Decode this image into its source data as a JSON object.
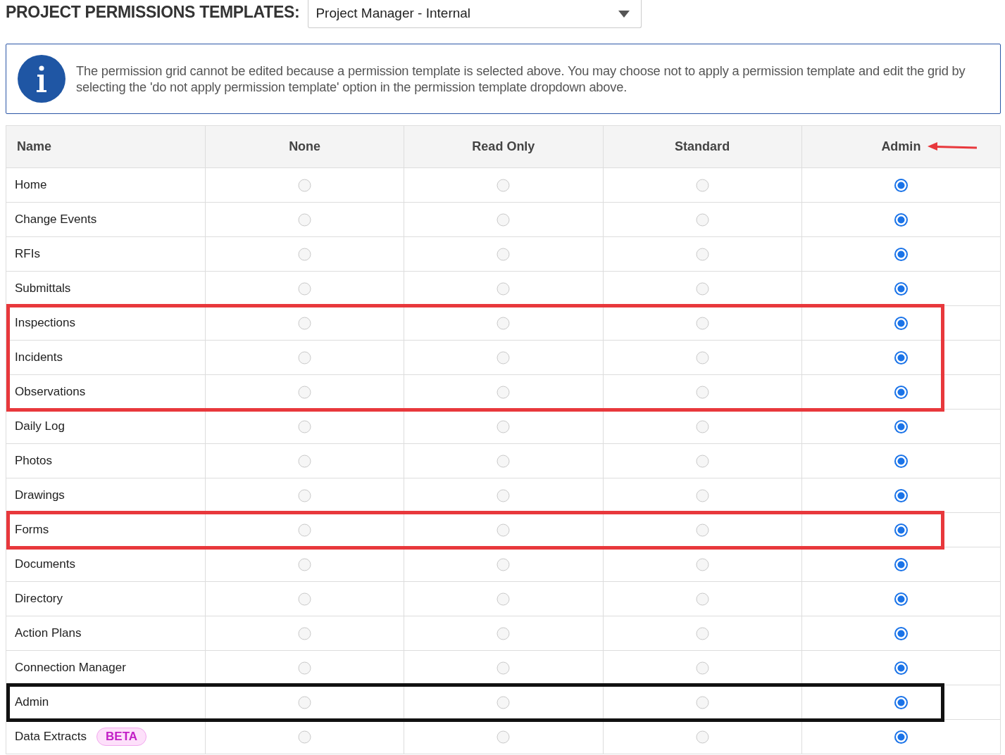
{
  "template": {
    "label": "PROJECT PERMISSIONS TEMPLATES:",
    "value": "Project Manager - Internal"
  },
  "info": {
    "text": "The permission grid cannot be edited because a permission template is selected above. You may choose not to apply a permission template and edit the grid by selecting the 'do not apply permission template' option in the permission template dropdown above."
  },
  "table": {
    "columns": [
      {
        "label": "Name",
        "arrow": false
      },
      {
        "label": "None",
        "arrow": false
      },
      {
        "label": "Read Only",
        "arrow": false
      },
      {
        "label": "Standard",
        "arrow": false
      },
      {
        "label": "Admin",
        "arrow": true
      }
    ],
    "rows": [
      {
        "name": "Home",
        "choices": [
          {
            "selected": false
          },
          {
            "selected": false
          },
          {
            "selected": false
          },
          {
            "selected": true
          }
        ]
      },
      {
        "name": "Change Events",
        "choices": [
          {
            "selected": false
          },
          {
            "selected": false
          },
          {
            "selected": false
          },
          {
            "selected": true
          }
        ]
      },
      {
        "name": "RFIs",
        "choices": [
          {
            "selected": false
          },
          {
            "selected": false
          },
          {
            "selected": false
          },
          {
            "selected": true
          }
        ]
      },
      {
        "name": "Submittals",
        "choices": [
          {
            "selected": false
          },
          {
            "selected": false
          },
          {
            "selected": false
          },
          {
            "selected": true
          }
        ]
      },
      {
        "name": "Inspections",
        "color": "#e8383c",
        "choices": [
          {
            "selected": false
          },
          {
            "selected": false
          },
          {
            "selected": false
          },
          {
            "selected": true
          }
        ]
      },
      {
        "name": "Incidents",
        "color": "#e8383c",
        "choices": [
          {
            "selected": false
          },
          {
            "selected": false
          },
          {
            "selected": false
          },
          {
            "selected": true
          }
        ]
      },
      {
        "name": "Observations",
        "color": "#e8383c",
        "choices": [
          {
            "selected": false
          },
          {
            "selected": false
          },
          {
            "selected": false
          },
          {
            "selected": true
          }
        ]
      },
      {
        "name": "Daily Log",
        "choices": [
          {
            "selected": false
          },
          {
            "selected": false
          },
          {
            "selected": false
          },
          {
            "selected": true
          }
        ]
      },
      {
        "name": "Photos",
        "choices": [
          {
            "selected": false
          },
          {
            "selected": false
          },
          {
            "selected": false
          },
          {
            "selected": true
          }
        ]
      },
      {
        "name": "Drawings",
        "choices": [
          {
            "selected": false
          },
          {
            "selected": false
          },
          {
            "selected": false
          },
          {
            "selected": true
          }
        ]
      },
      {
        "name": "Forms",
        "color": "#e8383c",
        "choices": [
          {
            "selected": false
          },
          {
            "selected": false
          },
          {
            "selected": false
          },
          {
            "selected": true
          }
        ]
      },
      {
        "name": "Documents",
        "choices": [
          {
            "selected": false
          },
          {
            "selected": false
          },
          {
            "selected": false
          },
          {
            "selected": true
          }
        ]
      },
      {
        "name": "Directory",
        "choices": [
          {
            "selected": false
          },
          {
            "selected": false
          },
          {
            "selected": false
          },
          {
            "selected": true
          }
        ]
      },
      {
        "name": "Action Plans",
        "choices": [
          {
            "selected": false
          },
          {
            "selected": false
          },
          {
            "selected": false
          },
          {
            "selected": true
          }
        ]
      },
      {
        "name": "Connection Manager",
        "choices": [
          {
            "selected": false
          },
          {
            "selected": false
          },
          {
            "selected": false
          },
          {
            "selected": true
          }
        ]
      },
      {
        "name": "Admin",
        "color": "#111111",
        "choices": [
          {
            "selected": false
          },
          {
            "selected": false
          },
          {
            "selected": false
          },
          {
            "selected": true
          }
        ]
      },
      {
        "name": "Data Extracts",
        "badge": "BETA",
        "choices": [
          {
            "selected": false
          },
          {
            "selected": false
          },
          {
            "selected": false
          },
          {
            "selected": true
          }
        ]
      }
    ]
  }
}
